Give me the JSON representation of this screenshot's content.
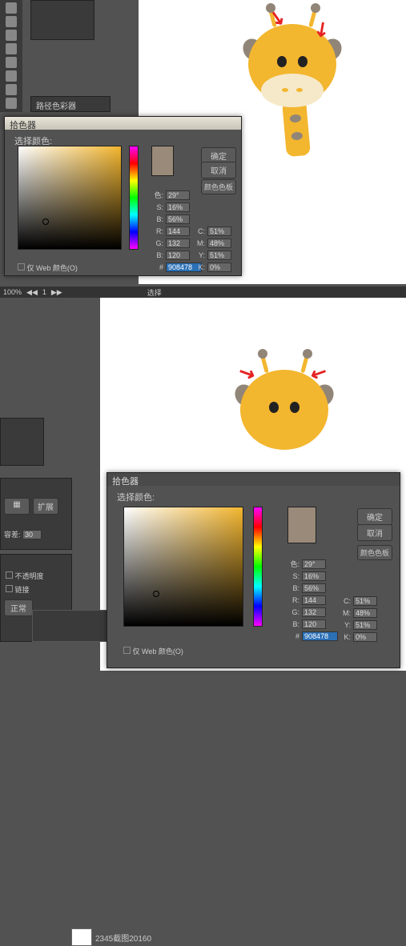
{
  "picker": {
    "title": "拾色器",
    "select_label": "选择颜色:",
    "ok": "确定",
    "cancel": "取消",
    "lib": "颜色色板",
    "new_color": "#908478",
    "H": {
      "label": "色: ",
      "value": "29°"
    },
    "S": {
      "label": "S: ",
      "value": "16%"
    },
    "B": {
      "label": "B: ",
      "value": "56%"
    },
    "R": {
      "label": "R: ",
      "value": "144"
    },
    "G": {
      "label": "G: ",
      "value": "132"
    },
    "Bl": {
      "label": "B: ",
      "value": "120"
    },
    "hex": {
      "label": "# ",
      "value": "908478"
    },
    "C": {
      "label": "C: ",
      "value": "51%"
    },
    "M": {
      "label": "M: ",
      "value": "48%"
    },
    "Y": {
      "label": "Y: ",
      "value": "51%"
    },
    "K": {
      "label": "K: ",
      "value": "0%"
    },
    "web_limit": "仅 Web 颜色(O)"
  },
  "zoom": {
    "value": "100%",
    "page": "1"
  },
  "panel": {
    "path": "路径色彩器",
    "opacity": "不透明度",
    "link": "链接",
    "normal": "正常",
    "expand": "扩展",
    "tolerance": "容差:",
    "layer_thumb": "2345截图20160"
  }
}
